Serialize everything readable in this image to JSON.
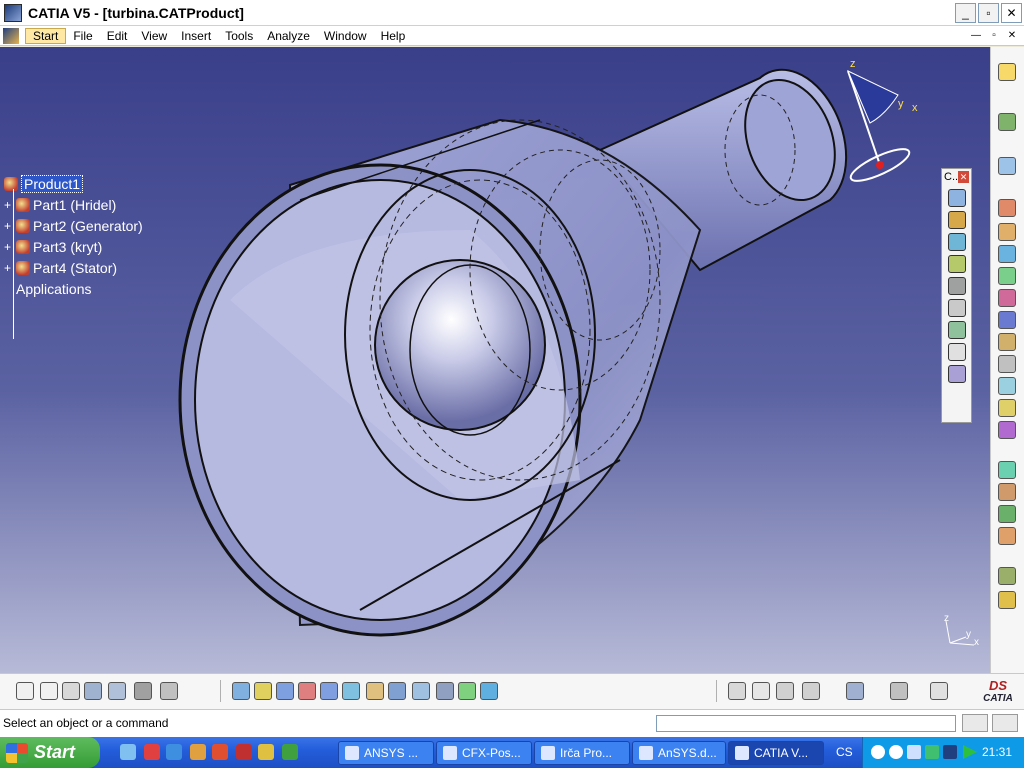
{
  "window": {
    "title": "CATIA V5 - [turbina.CATProduct]",
    "minimize": "_",
    "maximize": "▫",
    "close": "✕"
  },
  "menu": {
    "items": [
      "Start",
      "File",
      "Edit",
      "View",
      "Insert",
      "Tools",
      "Analyze",
      "Window",
      "Help"
    ],
    "mdi_minimize": "—",
    "mdi_restore": "▫",
    "mdi_close": "✕"
  },
  "tree": {
    "root": "Product1",
    "children": [
      "Part1 (Hridel)",
      "Part2 (Generator)",
      "Part3 (kryt)",
      "Part4 (Stator)"
    ],
    "applications": "Applications"
  },
  "compass": {
    "z": "z",
    "y": "y",
    "x": "x"
  },
  "axis_indicator": {
    "z": "z",
    "y": "y",
    "x": "x"
  },
  "float_toolbar": {
    "title": "C..",
    "close": "✕"
  },
  "logo": {
    "mark": "DS",
    "name": "CATIA"
  },
  "status": {
    "message": "Select an object or a command",
    "command_input": ""
  },
  "taskbar": {
    "start": "Start",
    "tasks": [
      "ANSYS ...",
      "CFX-Pos...",
      "Irča Pro...",
      "AnSYS.d...",
      "CATIA V..."
    ],
    "language": "CS",
    "clock": "21:31"
  },
  "icons": {
    "right_toolbar": [
      "select-arrow-icon",
      "fly-mode-icon",
      "move-icon",
      "product-icon",
      "component-icon",
      "part-icon",
      "existing-component-icon",
      "replace-icon",
      "graph-tree-icon",
      "renumber-icon",
      "bill-of-material-icon",
      "reset-position-icon",
      "generate-numbering-icon",
      "multi-instance-icon",
      "manipulation-icon",
      "snap-icon",
      "explode-icon",
      "stop-clash-icon",
      "catalog-icon",
      "scene-icon"
    ],
    "bottom_toolbar": [
      "formula-icon",
      "comment-icon",
      "knowledge-icon",
      "table-icon",
      "hierarchy-icon",
      "lock-icon",
      "vector-icon",
      "fit-all-icon",
      "pan-icon",
      "rotate-icon",
      "zoom-in-icon",
      "zoom-out-icon",
      "normal-view-icon",
      "multi-view-icon",
      "iso-view-icon",
      "render-style-icon",
      "hide-show-icon",
      "swap-space-icon",
      "constraint-icon",
      "analysis-icon",
      "measure-icon",
      "scene-icon",
      "update-icon",
      "catia-logo-icon"
    ]
  },
  "colors": {
    "viewport_top": "#3a3f8a",
    "viewport_bottom": "#b7bad7",
    "selection": "#2d57c9",
    "taskbar": "#245edb",
    "start_button": "#3ea34a",
    "tray": "#0f9ae8"
  }
}
